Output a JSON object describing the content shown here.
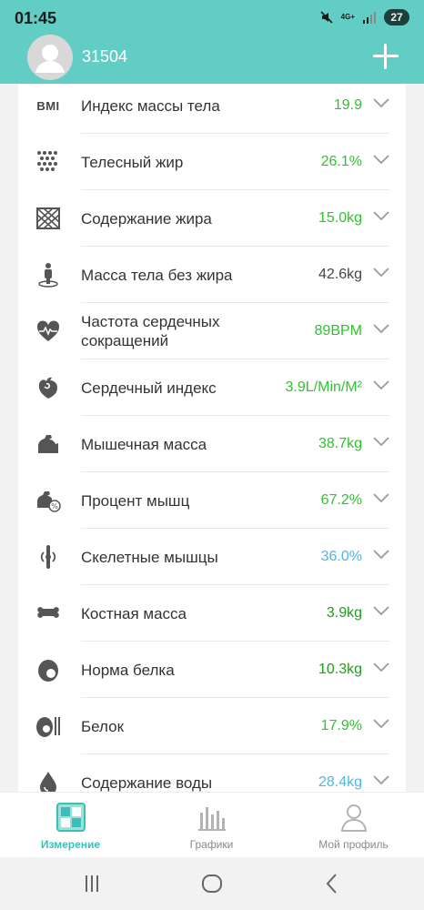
{
  "status_bar": {
    "time": "01:45",
    "network": "4G+",
    "battery": "27"
  },
  "header": {
    "user_name": "31504"
  },
  "colors": {
    "header": "#62cdc5",
    "green": "#2fc32f",
    "dark_green": "#1f9d1f",
    "blue": "#4fb6e6",
    "gray": "#444444",
    "accent": "#3cbfb8"
  },
  "metrics": [
    {
      "icon": "bmi-icon",
      "icon_text": "BMI",
      "label": "Индекс массы тела",
      "value": "19.9",
      "color": "#2fc32f"
    },
    {
      "icon": "body-fat-dots-icon",
      "label": "Телесный жир",
      "value": "26.1%",
      "color": "#2fc32f"
    },
    {
      "icon": "fat-content-icon",
      "label": "Содержание жира",
      "value": "15.0kg",
      "color": "#2fc32f"
    },
    {
      "icon": "lean-body-icon",
      "label": "Масса тела без жира",
      "value": "42.6kg",
      "color": "#444444"
    },
    {
      "icon": "heart-rate-icon",
      "label": "Частота сердечных сокращений",
      "value": "89BPM",
      "color": "#2fc32f"
    },
    {
      "icon": "heart-index-icon",
      "label": "Сердечный индекс",
      "value": "3.9L/Min/M²",
      "color": "#2fc32f"
    },
    {
      "icon": "muscle-icon",
      "label": "Мышечная масса",
      "value": "38.7kg",
      "color": "#2fc32f"
    },
    {
      "icon": "muscle-percent-icon",
      "label": "Процент мышц",
      "value": "67.2%",
      "color": "#2fc32f"
    },
    {
      "icon": "skeletal-muscle-icon",
      "label": "Скелетные мышцы",
      "value": "36.0%",
      "color": "#4fb6e6"
    },
    {
      "icon": "bone-icon",
      "label": "Костная масса",
      "value": "3.9kg",
      "color": "#1f9d1f"
    },
    {
      "icon": "protein-norm-icon",
      "label": "Норма белка",
      "value": "10.3kg",
      "color": "#1f9d1f"
    },
    {
      "icon": "protein-icon",
      "label": "Белок",
      "value": "17.9%",
      "color": "#2fc32f"
    },
    {
      "icon": "water-drop-icon",
      "label": "Содержание воды",
      "value": "28.4kg",
      "color": "#4fb6e6"
    }
  ],
  "tabs": [
    {
      "label": "Измерение",
      "icon": "measurement-icon",
      "active": true
    },
    {
      "label": "Графики",
      "icon": "charts-icon",
      "active": false
    },
    {
      "label": "Мой профиль",
      "icon": "profile-icon",
      "active": false
    }
  ]
}
